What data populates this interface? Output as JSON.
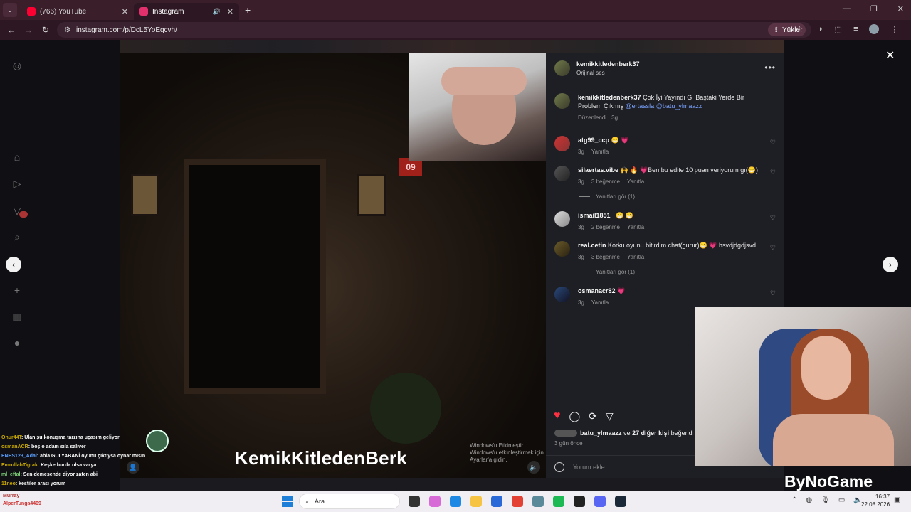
{
  "browser": {
    "tabs": [
      {
        "title": "(766) YouTube",
        "favicon_color": "#ff0033"
      },
      {
        "title": "Instagram",
        "favicon_color": "#e1306c",
        "active": true
      }
    ],
    "url": "instagram.com/p/DcL5YoEqcvh/",
    "upload_label": "Yükle"
  },
  "post": {
    "author": "kemikkitledenberk37",
    "audio": "Orijinal ses",
    "video_caption": "KemikKitledenBerk",
    "video_sign": "09",
    "watermark_line1": "Windows'u Etkinleştir",
    "watermark_line2": "Windows'u etkinleştirmek için Ayarlar'a gidin.",
    "caption": {
      "user": "kemikkitledenberk37",
      "text": "Çok İyi Yayındı Gı Baştaki Yerde Bir Problem Çıkmış",
      "mention1": "@ertassla",
      "mention2": "@batu_ylmaazz",
      "meta": "Düzenlendi · 3g"
    },
    "comments": [
      {
        "user": "atg99_ccp",
        "text": "😁 💗",
        "time": "3g",
        "likes": "",
        "reply": "Yanıtla",
        "replies": ""
      },
      {
        "user": "silaertas.vibe",
        "text": "🙌 🔥 💗Ben bu edite 10 puan veriyorum gı(😁)",
        "time": "3g",
        "likes": "3 beğenme",
        "reply": "Yanıtla",
        "replies": "Yanıtları gör (1)"
      },
      {
        "user": "ismail1851_",
        "text": "😁 😁",
        "time": "3g",
        "likes": "2 beğenme",
        "reply": "Yanıtla",
        "replies": ""
      },
      {
        "user": "real.cetin",
        "text": "Korku oyunu bitirdim chat(gurur)😁 💗 hsvdjdgdjsvd",
        "time": "3g",
        "likes": "3 beğenme",
        "reply": "Yanıtla",
        "replies": "Yanıtları gör (1)"
      },
      {
        "user": "osmanacr82",
        "text": "💗",
        "time": "3g",
        "likes": "",
        "reply": "Yanıtla",
        "replies": ""
      }
    ],
    "likes": {
      "user": "batu_ylmaazz",
      "joiner": "ve",
      "others": "27 diğer kişi",
      "suffix": "beğendi"
    },
    "when": "3 gün önce",
    "add_comment_placeholder": "Yorum ekle..."
  },
  "overlay": {
    "brand": "ByNoGame",
    "chat": [
      {
        "name": "Onur44T",
        "msg": ": Ulan şu konuşma tarzına uçasım geliyor",
        "cls": ""
      },
      {
        "name": "osmanACR",
        "msg": ": boş o adam sıla salıver",
        "cls": ""
      },
      {
        "name": "ENES123_Adal",
        "msg": ": abla GULYABANİ oyunu çıktıysa oynar mısın",
        "cls": "b"
      },
      {
        "name": "EmrullahTigrak",
        "msg": ": Keşke burda olsa varya",
        "cls": ""
      },
      {
        "name": "ml_eftal",
        "msg": ": Sen demesende diyor zaten abi",
        "cls": "g"
      },
      {
        "name": "11neo",
        "msg": ": kestiler arası yorum",
        "cls": ""
      }
    ],
    "bottom_users": [
      "Murray",
      "AlperTunga4409"
    ]
  },
  "taskbar": {
    "search_label": "Ara",
    "time": "16:37",
    "date": "22.08.2026"
  }
}
